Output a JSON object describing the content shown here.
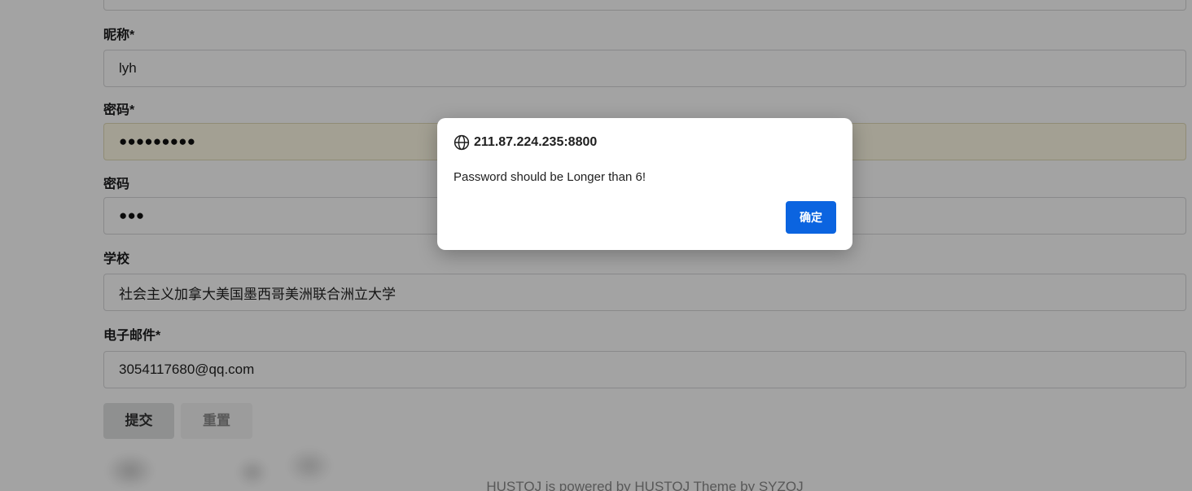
{
  "form": {
    "nickname": {
      "label": "昵称*",
      "value": "lyh"
    },
    "password": {
      "label": "密码*",
      "value": "●●●●●●●●●"
    },
    "password_confirm": {
      "label": "密码",
      "value": "●●●"
    },
    "school": {
      "label": "学校",
      "value": "社会主义加拿大美国墨西哥美洲联合洲立大学"
    },
    "email": {
      "label": "电子邮件*",
      "value": "3054117680@qq.com"
    },
    "submit_label": "提交",
    "reset_label": "重置"
  },
  "footer": {
    "text": "HUSTOJ is powered by HUSTOJ Theme by SYZOJ"
  },
  "dialog": {
    "icon": "globe-icon",
    "origin": "211.87.224.235:8800",
    "message": "Password should be Longer than 6!",
    "ok_label": "确定"
  },
  "colors": {
    "dialog_button": "#0b64e0",
    "autofill_background": "#fffbe6"
  }
}
